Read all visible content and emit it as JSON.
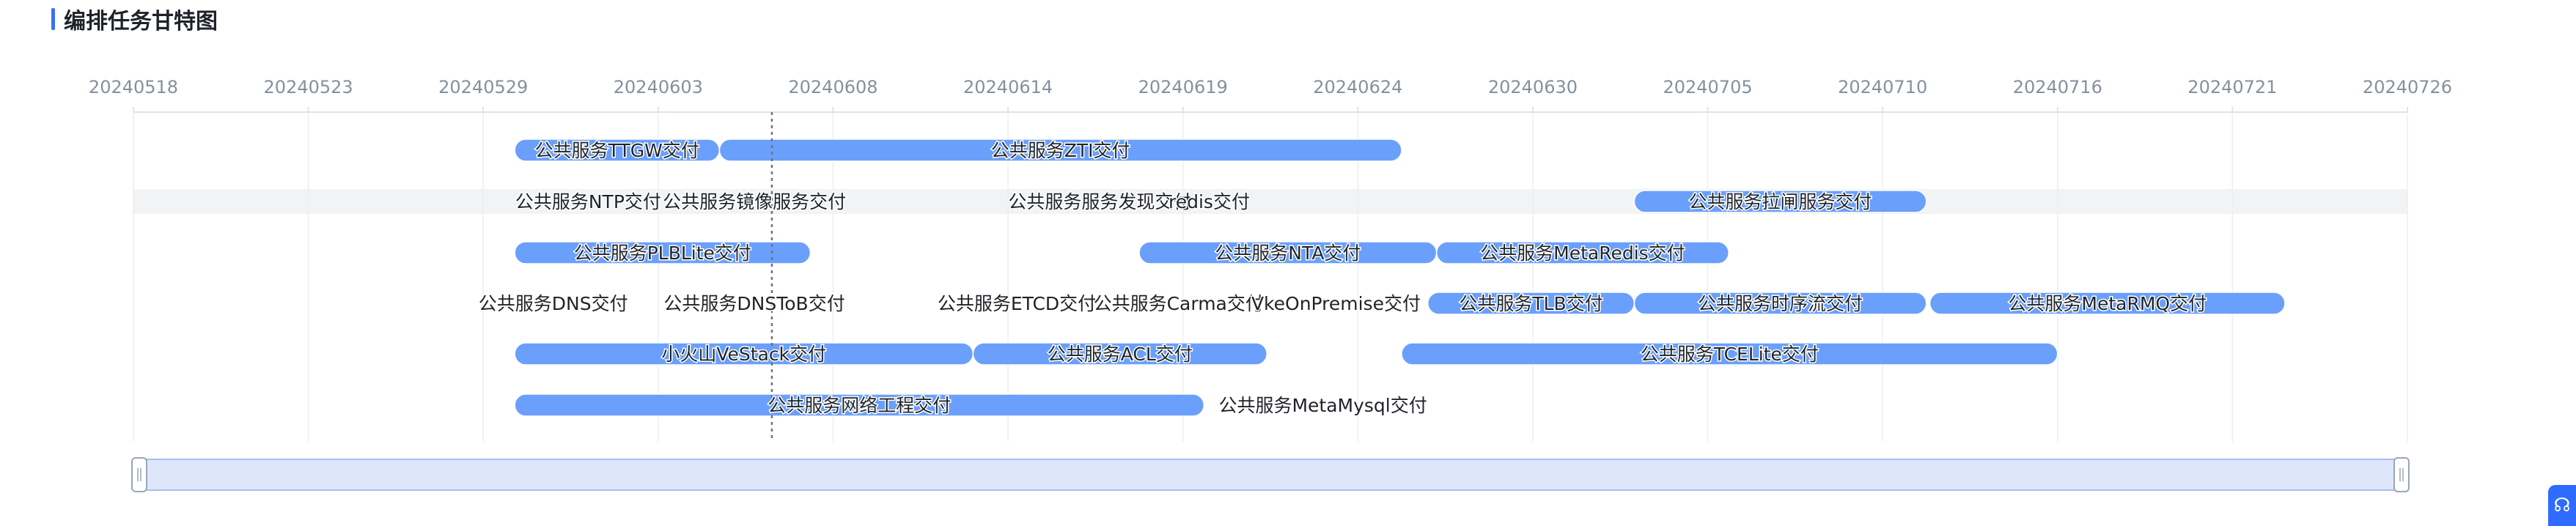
{
  "header": {
    "title": "编排任务甘特图"
  },
  "axis": {
    "ticks": [
      "20240518",
      "20240523",
      "20240529",
      "20240603",
      "20240608",
      "20240614",
      "20240619",
      "20240624",
      "20240630",
      "20240705",
      "20240710",
      "20240716",
      "20240721",
      "20240726"
    ]
  },
  "today_marker_tick_fraction": 3.65,
  "colors": {
    "bar": "#6aa0fb",
    "accent": "#3b6fff",
    "row_highlight": "#f2f3f5",
    "slider_fill": "#dde6fb",
    "slider_border": "#a8bef2"
  },
  "tasks": [
    {
      "label": "公共服务TTGW交付",
      "row": 0,
      "start": 2.18,
      "end": 3.35,
      "bar": true
    },
    {
      "label": "公共服务ZTI交付",
      "row": 0,
      "start": 3.35,
      "end": 7.25,
      "bar": true
    },
    {
      "label": "公共服务NTP交付",
      "row": 1,
      "start": 2.2,
      "end": 3.0,
      "bar": false
    },
    {
      "label": "公共服务镜像服务交付",
      "row": 1,
      "start": 2.7,
      "end": 4.4,
      "bar": false
    },
    {
      "label": "公共服务服务发现交付",
      "row": 1,
      "start": 4.95,
      "end": 6.1,
      "bar": false
    },
    {
      "label": "redis交付",
      "row": 1,
      "start": 5.9,
      "end": 6.4,
      "bar": false
    },
    {
      "label": "公共服务拉闸服务交付",
      "row": 1,
      "start": 8.58,
      "end": 10.25,
      "bar": true
    },
    {
      "label": "公共服务PLBLite交付",
      "row": 2,
      "start": 2.18,
      "end": 3.87,
      "bar": true
    },
    {
      "label": "公共服务NTA交付",
      "row": 2,
      "start": 5.75,
      "end": 7.45,
      "bar": true
    },
    {
      "label": "公共服务MetaRedis交付",
      "row": 2,
      "start": 7.45,
      "end": 9.12,
      "bar": true
    },
    {
      "label": "公共服务DNS交付",
      "row": 3,
      "start": 1.9,
      "end": 2.9,
      "bar": false
    },
    {
      "label": "公共服务DNSToB交付",
      "row": 3,
      "start": 2.9,
      "end": 4.2,
      "bar": false
    },
    {
      "label": "公共服务ETCD交付",
      "row": 3,
      "start": 4.5,
      "end": 5.6,
      "bar": false
    },
    {
      "label": "公共服务Carma交付",
      "row": 3,
      "start": 5.35,
      "end": 6.6,
      "bar": false
    },
    {
      "label": "VkeOnPremise交付",
      "row": 3,
      "start": 6.35,
      "end": 7.4,
      "bar": false
    },
    {
      "label": "公共服务TLB交付",
      "row": 3,
      "start": 7.4,
      "end": 8.58,
      "bar": true
    },
    {
      "label": "公共服务时序流交付",
      "row": 3,
      "start": 8.58,
      "end": 10.25,
      "bar": true
    },
    {
      "label": "公共服务MetaRMQ交付",
      "row": 3,
      "start": 10.27,
      "end": 12.3,
      "bar": true
    },
    {
      "label": "小火山VeStack交付",
      "row": 4,
      "start": 2.18,
      "end": 4.8,
      "bar": true
    },
    {
      "label": "公共服务ACL交付",
      "row": 4,
      "start": 4.8,
      "end": 6.48,
      "bar": true
    },
    {
      "label": "公共服务TCELite交付",
      "row": 4,
      "start": 7.25,
      "end": 11.0,
      "bar": true
    },
    {
      "label": "公共服务网络工程交付",
      "row": 5,
      "start": 2.18,
      "end": 6.12,
      "bar": true
    },
    {
      "label": "公共服务MetaMysql交付",
      "row": 5,
      "start": 6.1,
      "end": 7.5,
      "bar": false
    }
  ],
  "corner_button": {
    "icon": "customer-service-icon"
  }
}
